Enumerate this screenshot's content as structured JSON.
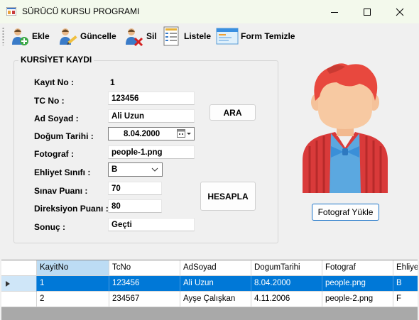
{
  "window": {
    "title": "SÜRÜCÜ KURSU PROGRAMI",
    "minimize_icon": "minimize-icon",
    "maximize_icon": "maximize-icon",
    "close_icon": "close-icon"
  },
  "toolbar": {
    "items": [
      {
        "label": "Ekle",
        "icon": "add-user-icon"
      },
      {
        "label": "Güncelle",
        "icon": "edit-user-icon"
      },
      {
        "label": "Sil",
        "icon": "delete-user-icon"
      },
      {
        "label": "Listele",
        "icon": "list-document-icon"
      },
      {
        "label": "Form Temizle",
        "icon": "clear-form-icon"
      }
    ]
  },
  "form": {
    "group_title": "KURSİYET KAYDI",
    "kayit_no_label": "Kayıt No :",
    "kayit_no_value": "1",
    "tc_label": "TC No :",
    "tc_value": "123456",
    "ad_soyad_label": "Ad Soyad :",
    "ad_soyad_value": "Ali Uzun",
    "dogum_label": "Doğum Tarihi :",
    "dogum_value": "8.04.2000",
    "fotograf_label": "Fotograf :",
    "fotograf_value": "people-1.png",
    "ehliyet_label": "Ehliyet Sınıfı :",
    "ehliyet_value": "B",
    "sinav_label": "Sınav Puanı :",
    "sinav_value": "70",
    "direksiyon_label": "Direksiyon Puanı :",
    "direksiyon_value": "80",
    "sonuc_label": "Sonuç :",
    "sonuc_value": "Geçti",
    "ara_button": "ARA",
    "hesapla_button": "HESAPLA",
    "yukle_button": "Fotograf Yükle"
  },
  "grid": {
    "columns": [
      "KayitNo",
      "TcNo",
      "AdSoyad",
      "DogumTarihi",
      "Fotograf",
      "Ehliyet"
    ],
    "rows": [
      [
        "1",
        "123456",
        "Ali Uzun",
        "8.04.2000",
        "people.png",
        "B"
      ],
      [
        "2",
        "234567",
        "Ayşe Çalışkan",
        "4.11.2006",
        "people-2.png",
        "F"
      ]
    ]
  },
  "colors": {
    "titlebar": "#f3f9ec",
    "selection": "#0078d7",
    "header_selected": "#bcdcf4"
  }
}
